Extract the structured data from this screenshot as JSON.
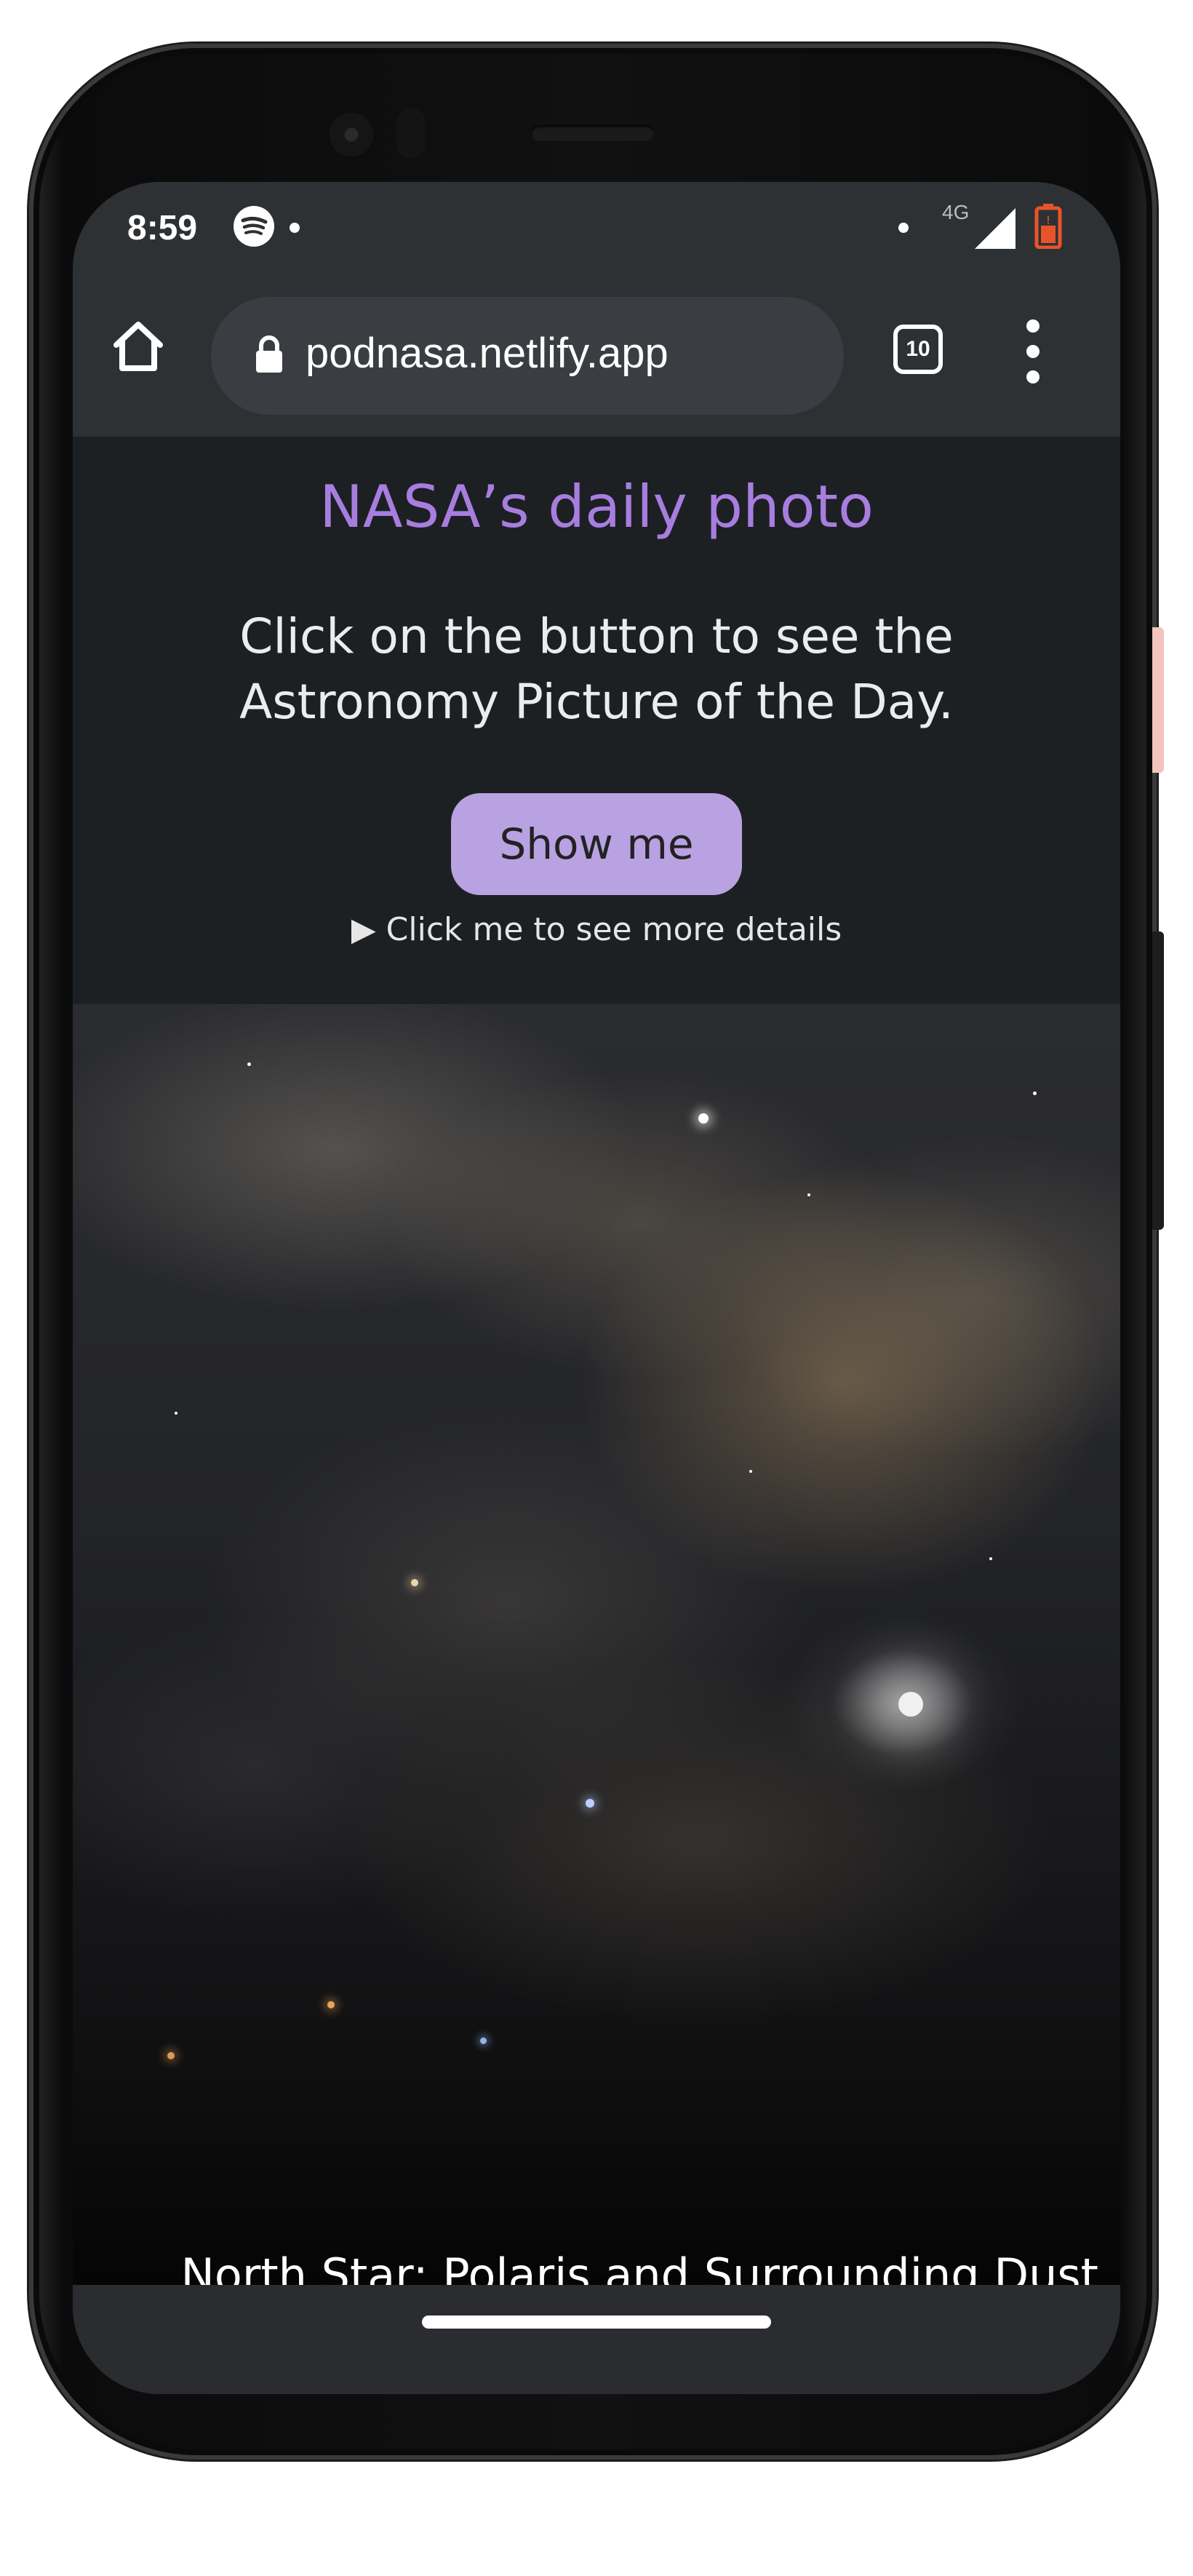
{
  "status_bar": {
    "time": "8:59",
    "network": "4G",
    "icons": [
      "spotify-icon",
      "signal-icon",
      "battery-icon"
    ],
    "battery_color": "#e8542a"
  },
  "browser": {
    "url": "podnasa.netlify.app",
    "tab_count": "10",
    "icons": [
      "home-icon",
      "lock-icon",
      "menu-icon"
    ]
  },
  "page": {
    "title": "NASA’s daily photo",
    "intro": "Click on the button to see the Astronomy Picture of the Day.",
    "button_label": "Show me",
    "details_label": "▶ Click me to see more details",
    "photo_caption": "North Star: Polaris and Surrounding Dust",
    "title_color": "#a87de0",
    "button_color": "#b9a2e2",
    "background_color": "#1d2022"
  }
}
